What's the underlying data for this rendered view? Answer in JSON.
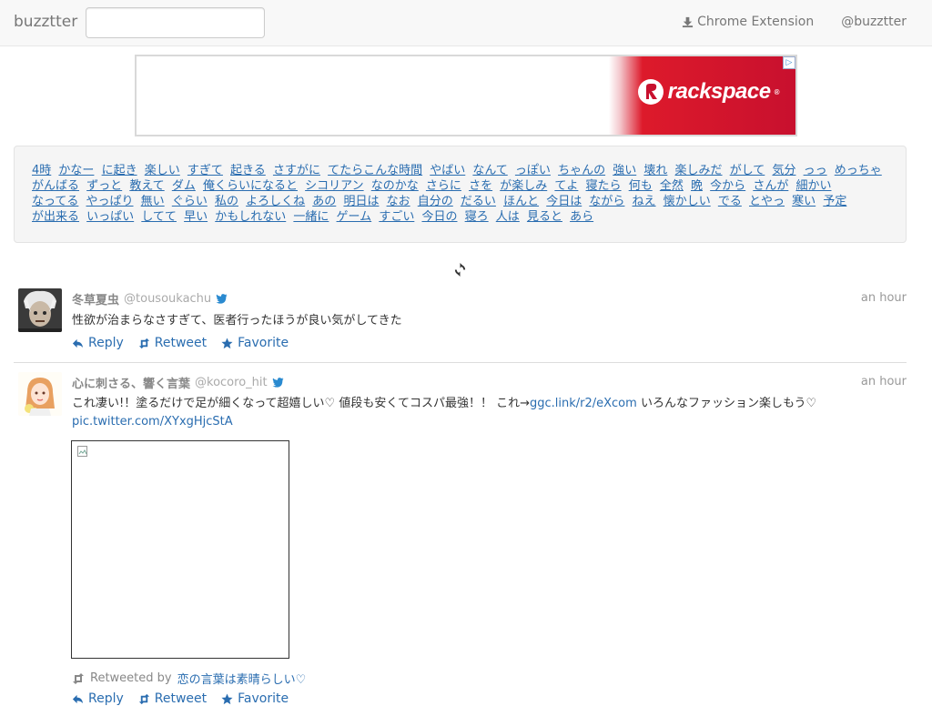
{
  "navbar": {
    "brand": "buzztter",
    "search_value": "",
    "chrome_extension": "Chrome Extension",
    "account": "@buzztter"
  },
  "ad": {
    "logo_text": "rackspace",
    "trademark": "®",
    "ad_choice": "▷"
  },
  "keywords": [
    "4時",
    "かなー",
    "に起き",
    "楽しい",
    "すぎて",
    "起きる",
    "さすがに",
    "てたらこんな時間",
    "やばい",
    "なんて",
    "っぽい",
    "ちゃんの",
    "強い",
    "壊れ",
    "楽しみだ",
    "がして",
    "気分",
    "っっ",
    "めっちゃ",
    "がんばる",
    "ずっと",
    "教えて",
    "ダム",
    "俺くらいになると",
    "シコリアン",
    "なのかな",
    "さらに",
    "さを",
    "が楽しみ",
    "てよ",
    "寝たら",
    "何も",
    "全然",
    "晩",
    "今から",
    "さんが",
    "細かい",
    "なってる",
    "やっぱり",
    "無い",
    "ぐらい",
    "私の",
    "よろしくね",
    "あの",
    "明日は",
    "なお",
    "自分の",
    "だるい",
    "ほんと",
    "今日は",
    "ながら",
    "ねえ",
    "懐かしい",
    "でる",
    "とやっ",
    "寒い",
    "予定",
    "が出来る",
    "いっぱい",
    "してて",
    "早い",
    "かもしれない",
    "一緒に",
    "ゲーム",
    "すごい",
    "今日の",
    "寝ろ",
    "人は",
    "見ると",
    "あら"
  ],
  "tweets": [
    {
      "name": "冬草夏虫",
      "handle": "@tousoukachu",
      "time": "an hour",
      "text": "性欲が治まらなさすぎて、医者行ったほうが良い気がしてきた",
      "reply": "Reply",
      "retweet": "Retweet",
      "favorite": "Favorite"
    },
    {
      "name": "心に刺さる、響く言葉",
      "handle": "@kocoro_hit",
      "time": "an hour",
      "text_before": "これ凄い!！塗るだけで足が細くなって超嬉しい♡ 値段も安くてコスパ最強！！ これ→",
      "link1": "ggc.link/r2/eXcom",
      "text_after": " いろんなファッション楽しもう♡",
      "link2": "pic.twitter.com/XYxgHjcStA",
      "retweeted_by_label": "Retweeted by",
      "retweeted_by": "恋の言葉は素晴らしい♡",
      "reply": "Reply",
      "retweet": "Retweet",
      "favorite": "Favorite"
    }
  ]
}
